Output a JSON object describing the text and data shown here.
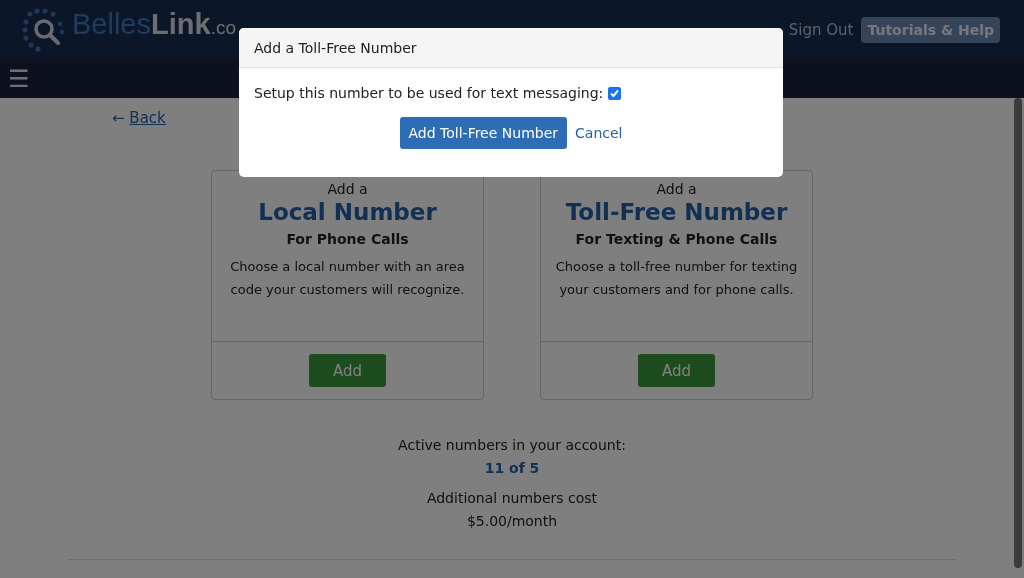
{
  "header": {
    "logo": {
      "first": "Belles",
      "second": "Link",
      "suffix": ".co"
    },
    "links": [
      "Sign Out"
    ],
    "help_button": "Tutorials & Help"
  },
  "nav": {
    "menu_icon": "☰"
  },
  "back_link": {
    "arrow": "←",
    "label": "Back"
  },
  "cards": [
    {
      "intro": "Add a",
      "title": "Local Number",
      "subtitle": "For Phone Calls",
      "description": "Choose a local number with an area code your customers will recognize.",
      "button": "Add"
    },
    {
      "intro": "Add a",
      "title": "Toll-Free Number",
      "subtitle": "For Texting & Phone Calls",
      "description": "Choose a toll-free number for texting your customers and for phone calls.",
      "button": "Add"
    }
  ],
  "summary": {
    "label": "Active numbers in your account:",
    "count": "11 of 5",
    "cost_label": "Additional numbers cost",
    "cost": "$5.00/month"
  },
  "modal": {
    "title": "Add a Toll-Free Number",
    "checkbox_label": "Setup this number to be used for text messaging:",
    "checked": true,
    "primary_button": "Add Toll-Free Number",
    "cancel_link": "Cancel"
  }
}
